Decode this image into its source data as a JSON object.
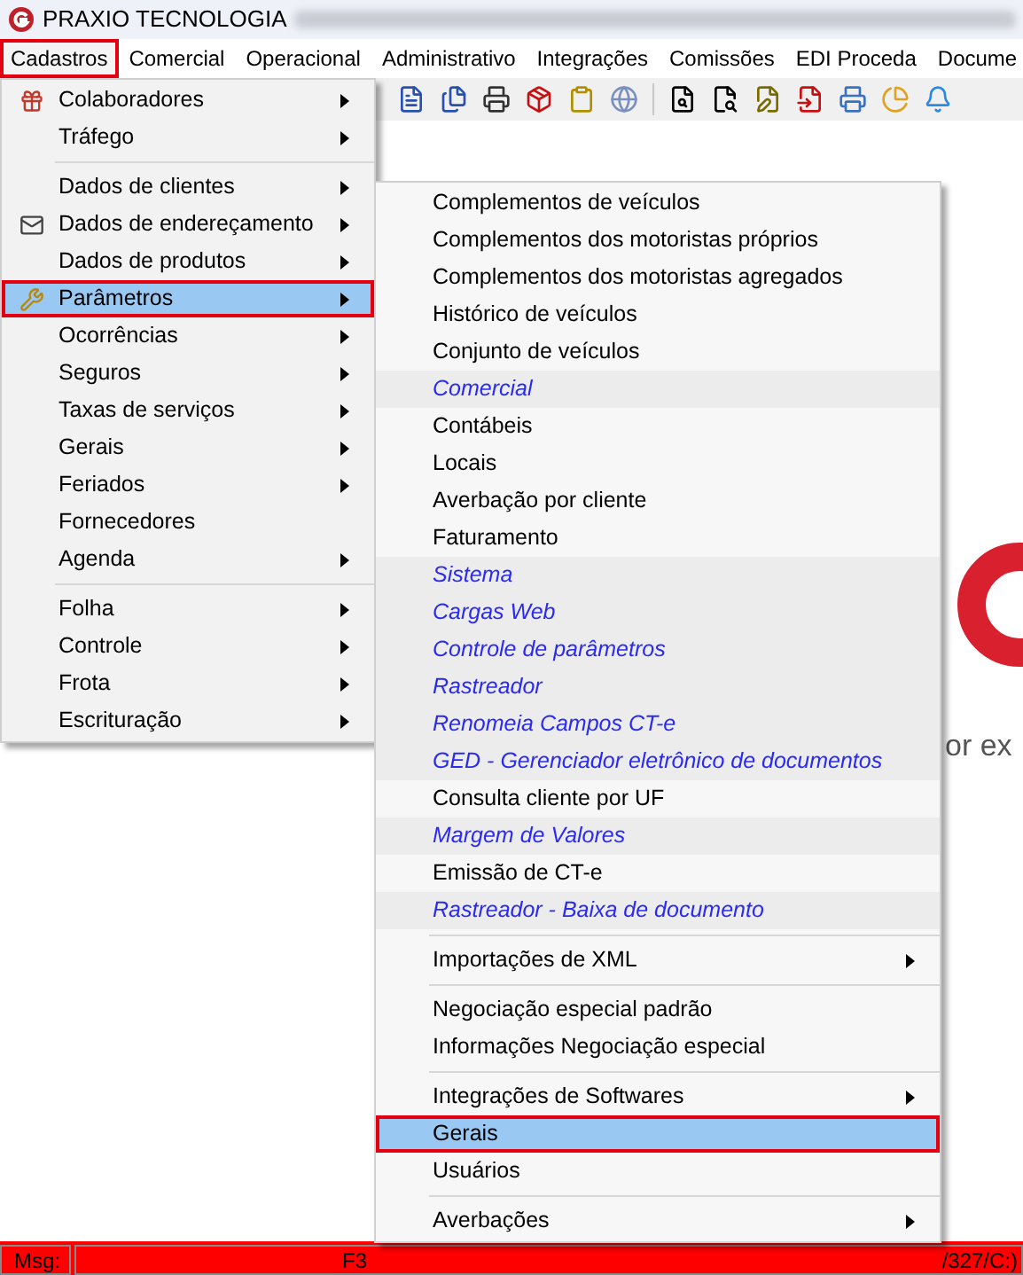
{
  "title_bar": {
    "app_name": "PRAXIO TECNOLOGIA"
  },
  "menu_bar": [
    {
      "label": "Cadastros",
      "selected": true
    },
    {
      "label": "Comercial",
      "selected": false
    },
    {
      "label": "Operacional",
      "selected": false
    },
    {
      "label": "Administrativo",
      "selected": false
    },
    {
      "label": "Integrações",
      "selected": false
    },
    {
      "label": "Comissões",
      "selected": false
    },
    {
      "label": "EDI Proceda",
      "selected": false
    },
    {
      "label": "Docume",
      "selected": false
    }
  ],
  "main_menu": [
    {
      "kind": "item",
      "label": "Colaboradores",
      "has_submenu": true,
      "selected": false
    },
    {
      "kind": "item",
      "label": "Tráfego",
      "has_submenu": true,
      "selected": false
    },
    {
      "kind": "separator"
    },
    {
      "kind": "item",
      "label": "Dados de clientes",
      "has_submenu": true,
      "selected": false
    },
    {
      "kind": "item",
      "label": "Dados de endereçamento",
      "has_submenu": true,
      "selected": false
    },
    {
      "kind": "item",
      "label": "Dados de produtos",
      "has_submenu": true,
      "selected": false
    },
    {
      "kind": "item",
      "label": "Parâmetros",
      "has_submenu": true,
      "selected": true
    },
    {
      "kind": "item",
      "label": "Ocorrências",
      "has_submenu": true,
      "selected": false
    },
    {
      "kind": "item",
      "label": "Seguros",
      "has_submenu": true,
      "selected": false
    },
    {
      "kind": "item",
      "label": "Taxas de serviços",
      "has_submenu": true,
      "selected": false
    },
    {
      "kind": "item",
      "label": "Gerais",
      "has_submenu": true,
      "selected": false
    },
    {
      "kind": "item",
      "label": "Feriados",
      "has_submenu": true,
      "selected": false
    },
    {
      "kind": "item",
      "label": "Fornecedores",
      "has_submenu": false,
      "selected": false
    },
    {
      "kind": "item",
      "label": "Agenda",
      "has_submenu": true,
      "selected": false
    },
    {
      "kind": "separator"
    },
    {
      "kind": "item",
      "label": "Folha",
      "has_submenu": true,
      "selected": false
    },
    {
      "kind": "item",
      "label": "Controle",
      "has_submenu": true,
      "selected": false
    },
    {
      "kind": "item",
      "label": "Frota",
      "has_submenu": true,
      "selected": false
    },
    {
      "kind": "item",
      "label": "Escrituração",
      "has_submenu": true,
      "selected": false
    }
  ],
  "submenu": [
    {
      "kind": "item",
      "label": "Complementos de veículos",
      "has_submenu": false,
      "selected": false
    },
    {
      "kind": "item",
      "label": "Complementos dos motoristas próprios",
      "has_submenu": false,
      "selected": false
    },
    {
      "kind": "item",
      "label": "Complementos dos motoristas agregados",
      "has_submenu": false,
      "selected": false
    },
    {
      "kind": "item",
      "label": "Histórico de veículos",
      "has_submenu": false,
      "selected": false
    },
    {
      "kind": "item",
      "label": "Conjunto de veículos",
      "has_submenu": false,
      "selected": false
    },
    {
      "kind": "group",
      "label": "Comercial",
      "has_submenu": false,
      "selected": false
    },
    {
      "kind": "item",
      "label": "Contábeis",
      "has_submenu": false,
      "selected": false
    },
    {
      "kind": "item",
      "label": "Locais",
      "has_submenu": false,
      "selected": false
    },
    {
      "kind": "item",
      "label": "Averbação por cliente",
      "has_submenu": false,
      "selected": false
    },
    {
      "kind": "item",
      "label": "Faturamento",
      "has_submenu": false,
      "selected": false
    },
    {
      "kind": "group",
      "label": "Sistema",
      "has_submenu": false,
      "selected": false
    },
    {
      "kind": "group",
      "label": "Cargas Web",
      "has_submenu": false,
      "selected": false
    },
    {
      "kind": "group",
      "label": "Controle de parâmetros",
      "has_submenu": false,
      "selected": false
    },
    {
      "kind": "group",
      "label": "Rastreador",
      "has_submenu": false,
      "selected": false
    },
    {
      "kind": "group",
      "label": "Renomeia Campos CT-e",
      "has_submenu": false,
      "selected": false
    },
    {
      "kind": "group",
      "label": "GED - Gerenciador eletrônico de documentos",
      "has_submenu": false,
      "selected": false
    },
    {
      "kind": "item",
      "label": "Consulta cliente por UF",
      "has_submenu": false,
      "selected": false
    },
    {
      "kind": "group",
      "label": "Margem de Valores",
      "has_submenu": false,
      "selected": false
    },
    {
      "kind": "item",
      "label": "Emissão de CT-e",
      "has_submenu": false,
      "selected": false
    },
    {
      "kind": "group",
      "label": "Rastreador - Baixa de documento",
      "has_submenu": false,
      "selected": false
    },
    {
      "kind": "separator"
    },
    {
      "kind": "item",
      "label": "Importações de XML",
      "has_submenu": true,
      "selected": false
    },
    {
      "kind": "separator"
    },
    {
      "kind": "item",
      "label": "Negociação especial padrão",
      "has_submenu": false,
      "selected": false
    },
    {
      "kind": "item",
      "label": "Informações Negociação especial",
      "has_submenu": false,
      "selected": false
    },
    {
      "kind": "separator"
    },
    {
      "kind": "item",
      "label": "Integrações de Softwares",
      "has_submenu": true,
      "selected": false
    },
    {
      "kind": "item",
      "label": "Gerais",
      "has_submenu": false,
      "selected": true
    },
    {
      "kind": "item",
      "label": "Usuários",
      "has_submenu": false,
      "selected": false
    },
    {
      "kind": "separator"
    },
    {
      "kind": "item",
      "label": "Averbações",
      "has_submenu": true,
      "selected": false
    }
  ],
  "background_text": "or ex",
  "status_bar": {
    "label": "Msg:",
    "message_left": "F3",
    "message_right": "/327/C:)"
  }
}
